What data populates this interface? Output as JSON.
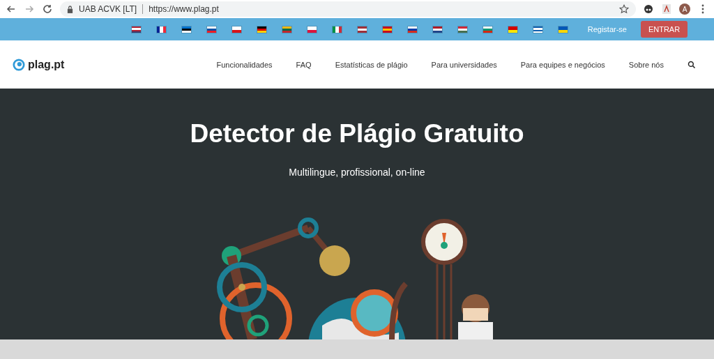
{
  "browser": {
    "site_label": "UAB ACVK [LT]",
    "url": "https://www.plag.pt",
    "profile_initial": "A"
  },
  "top_bar": {
    "register_link": "Registar-se",
    "login_button": "ENTRAR"
  },
  "nav": {
    "logo": "plag.pt",
    "items": [
      "Funcionalidades",
      "FAQ",
      "Estatísticas de plágio",
      "Para universidades",
      "Para equipes e negócios",
      "Sobre nós"
    ]
  },
  "hero": {
    "title": "Detector de Plágio Gratuito",
    "subtitle": "Multilingue, profissional, on-line"
  }
}
